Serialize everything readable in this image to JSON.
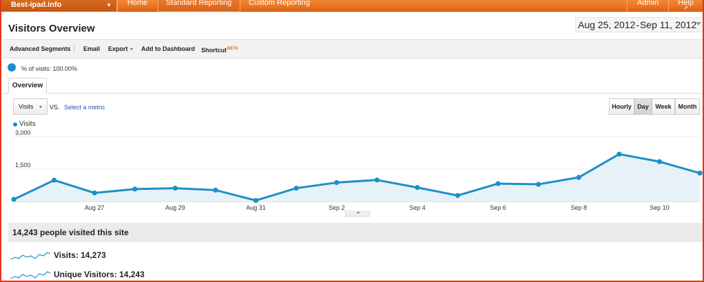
{
  "topnav": {
    "site": "Best-ipad.info",
    "items": [
      "Home",
      "Standard Reporting",
      "Custom Reporting",
      "Admin",
      "Help"
    ]
  },
  "page": {
    "title": "Visitors Overview",
    "date_start": "Aug 25, 2012",
    "date_end": "Sep 11, 2012"
  },
  "toolbar": {
    "advanced_segments": "Advanced Segments",
    "email": "Email",
    "export": "Export",
    "add_to_dashboard": "Add to Dashboard",
    "shortcut": "Shortcut",
    "beta": "BETA"
  },
  "segment": {
    "label": "% of visits: 100.00%",
    "color": "#1c8fc7"
  },
  "tabs": {
    "overview": "Overview"
  },
  "metric": {
    "selected": "Visits",
    "vs": "VS.",
    "select_metric": "Select a metric",
    "granularity": [
      "Hourly",
      "Day",
      "Week",
      "Month"
    ],
    "active_granularity": "Day"
  },
  "legend": {
    "series": "Visits"
  },
  "chart_data": {
    "type": "area",
    "series": [
      {
        "name": "Visits",
        "color": "#1c8fc7",
        "x": [
          "Aug 25",
          "Aug 26",
          "Aug 27",
          "Aug 28",
          "Aug 29",
          "Aug 30",
          "Aug 31",
          "Sep 1",
          "Sep 2",
          "Sep 3",
          "Sep 4",
          "Sep 5",
          "Sep 6",
          "Sep 7",
          "Sep 8",
          "Sep 9",
          "Sep 10",
          "Sep 11"
        ],
        "values": [
          100,
          990,
          400,
          580,
          620,
          530,
          50,
          620,
          880,
          1000,
          650,
          280,
          830,
          800,
          1120,
          2200,
          1850,
          1320
        ]
      }
    ],
    "x_tick_labels": [
      "Aug 27",
      "Aug 29",
      "Aug 31",
      "Sep 2",
      "Sep 4",
      "Sep 6",
      "Sep 8",
      "Sep 10"
    ],
    "y_tick_labels": [
      "1,500",
      "3,000"
    ],
    "ylim": [
      0,
      3000
    ],
    "grid": true
  },
  "summary": {
    "headline": "14,243 people visited this site",
    "stats": [
      {
        "label": "Visits: 14,273"
      },
      {
        "label": "Unique Visitors: 14,243"
      }
    ]
  }
}
